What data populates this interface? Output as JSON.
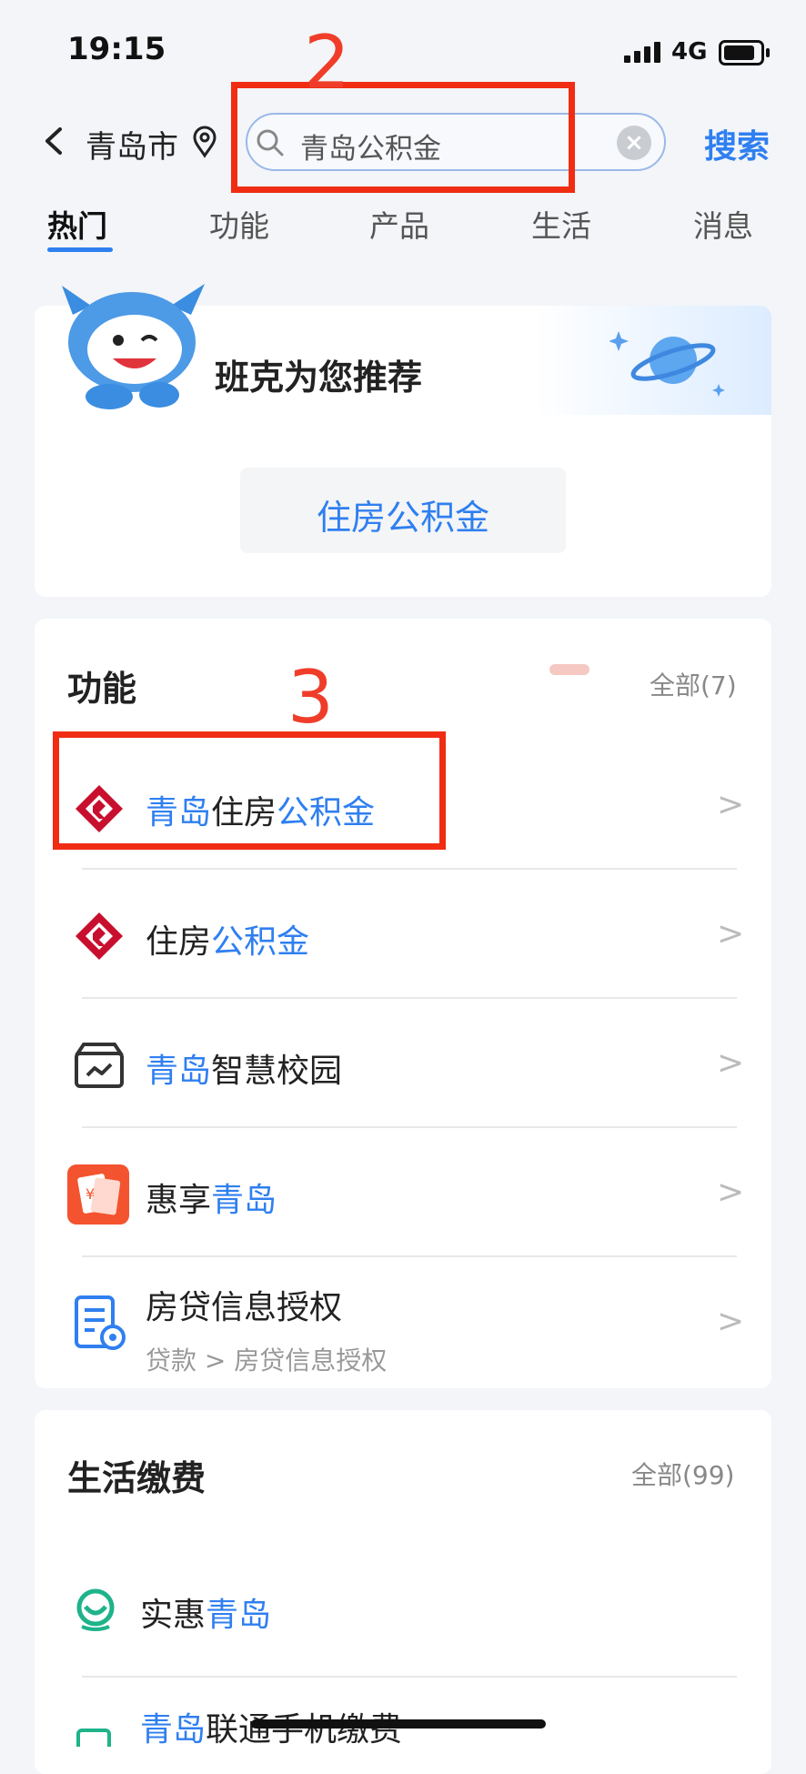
{
  "status_bar": {
    "time": "19:15",
    "network": "4G"
  },
  "header": {
    "city": "青岛市",
    "search_value": "青岛公积金",
    "search_button": "搜索"
  },
  "annotations": {
    "step2": "2",
    "step3": "3"
  },
  "tabs": [
    {
      "label": "热门",
      "active": true
    },
    {
      "label": "功能",
      "active": false
    },
    {
      "label": "产品",
      "active": false
    },
    {
      "label": "生活",
      "active": false
    },
    {
      "label": "消息",
      "active": false
    }
  ],
  "recommend": {
    "title": "班克为您推荐",
    "chip": "住房公积金"
  },
  "functions": {
    "title": "功能",
    "all_label": "全部(7)",
    "items": [
      {
        "parts": [
          {
            "text": "青岛",
            "hl": true
          },
          {
            "text": "住房",
            "hl": false
          },
          {
            "text": "公积金",
            "hl": true
          }
        ],
        "icon": "housing-fund-logo-icon"
      },
      {
        "parts": [
          {
            "text": "住房",
            "hl": false
          },
          {
            "text": "公积金",
            "hl": true
          }
        ],
        "icon": "housing-fund-logo-icon"
      },
      {
        "parts": [
          {
            "text": "青岛",
            "hl": true
          },
          {
            "text": "智慧校园",
            "hl": false
          }
        ],
        "icon": "campus-box-icon"
      },
      {
        "parts": [
          {
            "text": "惠享",
            "hl": false
          },
          {
            "text": "青岛",
            "hl": true
          }
        ],
        "icon": "red-envelope-icon"
      },
      {
        "parts": [
          {
            "text": "房贷信息授权",
            "hl": false
          }
        ],
        "sub": "贷款 > 房贷信息授权",
        "icon": "document-coin-icon"
      }
    ],
    "chevron": ">"
  },
  "life": {
    "title": "生活缴费",
    "all_label": "全部(99)",
    "items": [
      {
        "parts": [
          {
            "text": "实惠",
            "hl": false
          },
          {
            "text": "青岛",
            "hl": true
          }
        ],
        "icon": "shihui-logo-icon"
      },
      {
        "parts": [
          {
            "text": "青岛",
            "hl": true
          },
          {
            "text": "联通手机缴费",
            "hl": false
          }
        ],
        "icon": "phone-bill-icon"
      }
    ]
  },
  "colors": {
    "accent": "#2f7ff0",
    "annotation_red": "#f02d13",
    "brand_red": "#c8102e"
  }
}
